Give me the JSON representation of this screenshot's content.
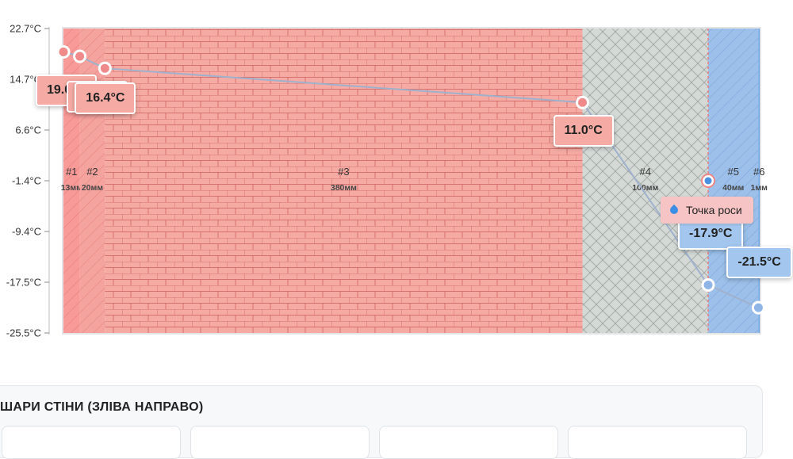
{
  "chart_data": {
    "type": "line",
    "title": "",
    "xlabel": "",
    "ylabel": "",
    "ylim": [
      -25.5,
      22.7
    ],
    "yticks": [
      "22.7°C",
      "14.7°C",
      "6.6°C",
      "-1.4°C",
      "-9.4°C",
      "-17.5°C",
      "-25.5°C"
    ],
    "total_thickness_mm": 554,
    "layers": [
      {
        "num": "#1",
        "thickness_mm": 13,
        "thickness_label": "13мм",
        "color": "#f79a98",
        "hatch": "diag"
      },
      {
        "num": "#2",
        "thickness_mm": 20,
        "thickness_label": "20мм",
        "color": "#f5a39e",
        "hatch": "diag"
      },
      {
        "num": "#3",
        "thickness_mm": 380,
        "thickness_label": "380мм",
        "color": "#f5aba3",
        "hatch": "brick"
      },
      {
        "num": "#4",
        "thickness_mm": 100,
        "thickness_label": "100мм",
        "color": "#d4d9d6",
        "hatch": "cross"
      },
      {
        "num": "#5",
        "thickness_mm": 40,
        "thickness_label": "40мм",
        "color": "#9cc0ea",
        "hatch": "diag"
      },
      {
        "num": "#6",
        "thickness_mm": 1,
        "thickness_label": "1мм",
        "color": "#6ea4e4",
        "hatch": "none"
      }
    ],
    "points": [
      {
        "x_mm": 0,
        "y": 19.0,
        "label": "19.0°C"
      },
      {
        "x_mm": 13,
        "y": 18.3,
        "label": "18.3°C"
      },
      {
        "x_mm": 33,
        "y": 16.4,
        "label": "16.4°C"
      },
      {
        "x_mm": 413,
        "y": 11.0,
        "label": "11.0°C"
      },
      {
        "x_mm": 513,
        "y": -17.9,
        "label": "-17.9°C"
      },
      {
        "x_mm": 553,
        "y": -21.5,
        "label": "-21.5°C"
      }
    ],
    "dew_point": {
      "x_mm": 513,
      "y": -1.4,
      "label": "Точка роси"
    }
  },
  "layers_section": {
    "title": "ШАРИ СТІНИ (ЗЛІВА НАПРАВО)"
  },
  "colors": {
    "line": "#9fb1cc",
    "dew_line": "#ef7a7a",
    "warm_label": "#f5aba3",
    "cold_label": "#a3c6ee"
  }
}
